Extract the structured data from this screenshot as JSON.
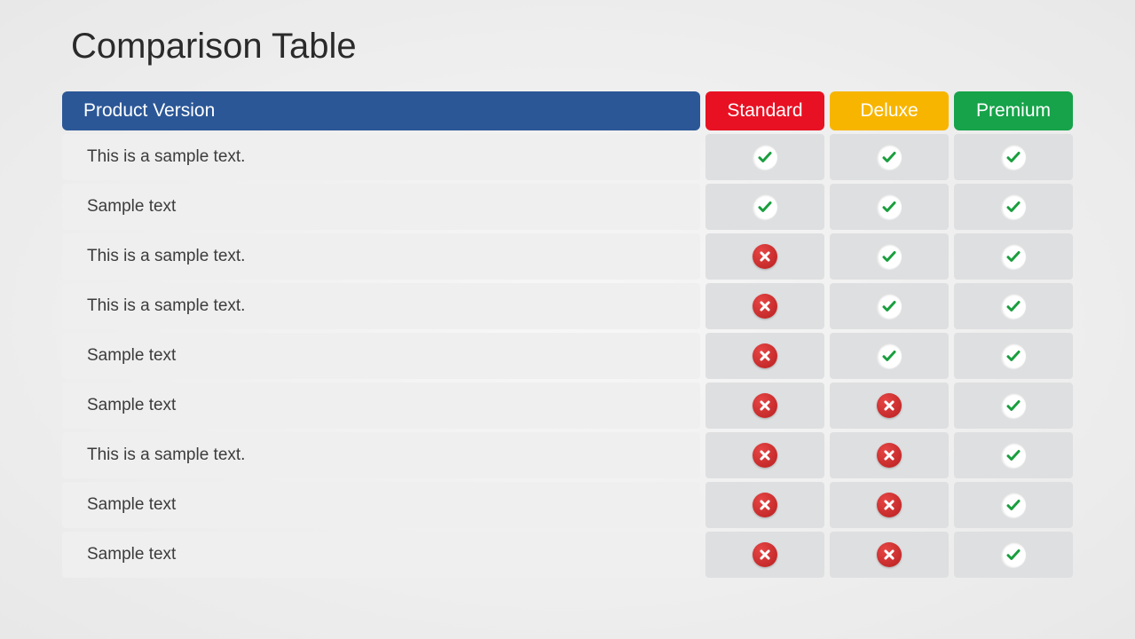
{
  "title": "Comparison Table",
  "colors": {
    "feature_header": "#2b5797",
    "plan_headers": [
      "#e81123",
      "#f7b500",
      "#16a34a"
    ]
  },
  "header": {
    "feature": "Product Version",
    "plans": [
      "Standard",
      "Deluxe",
      "Premium"
    ]
  },
  "rows": [
    {
      "label": "This is a sample text.",
      "values": [
        true,
        true,
        true
      ]
    },
    {
      "label": "Sample text",
      "values": [
        true,
        true,
        true
      ]
    },
    {
      "label": "This is a sample text.",
      "values": [
        false,
        true,
        true
      ]
    },
    {
      "label": "This is a sample text.",
      "values": [
        false,
        true,
        true
      ]
    },
    {
      "label": "Sample text",
      "values": [
        false,
        true,
        true
      ]
    },
    {
      "label": "Sample text",
      "values": [
        false,
        false,
        true
      ]
    },
    {
      "label": "This is a sample text.",
      "values": [
        false,
        false,
        true
      ]
    },
    {
      "label": "Sample text",
      "values": [
        false,
        false,
        true
      ]
    },
    {
      "label": "Sample text",
      "values": [
        false,
        false,
        true
      ]
    }
  ]
}
